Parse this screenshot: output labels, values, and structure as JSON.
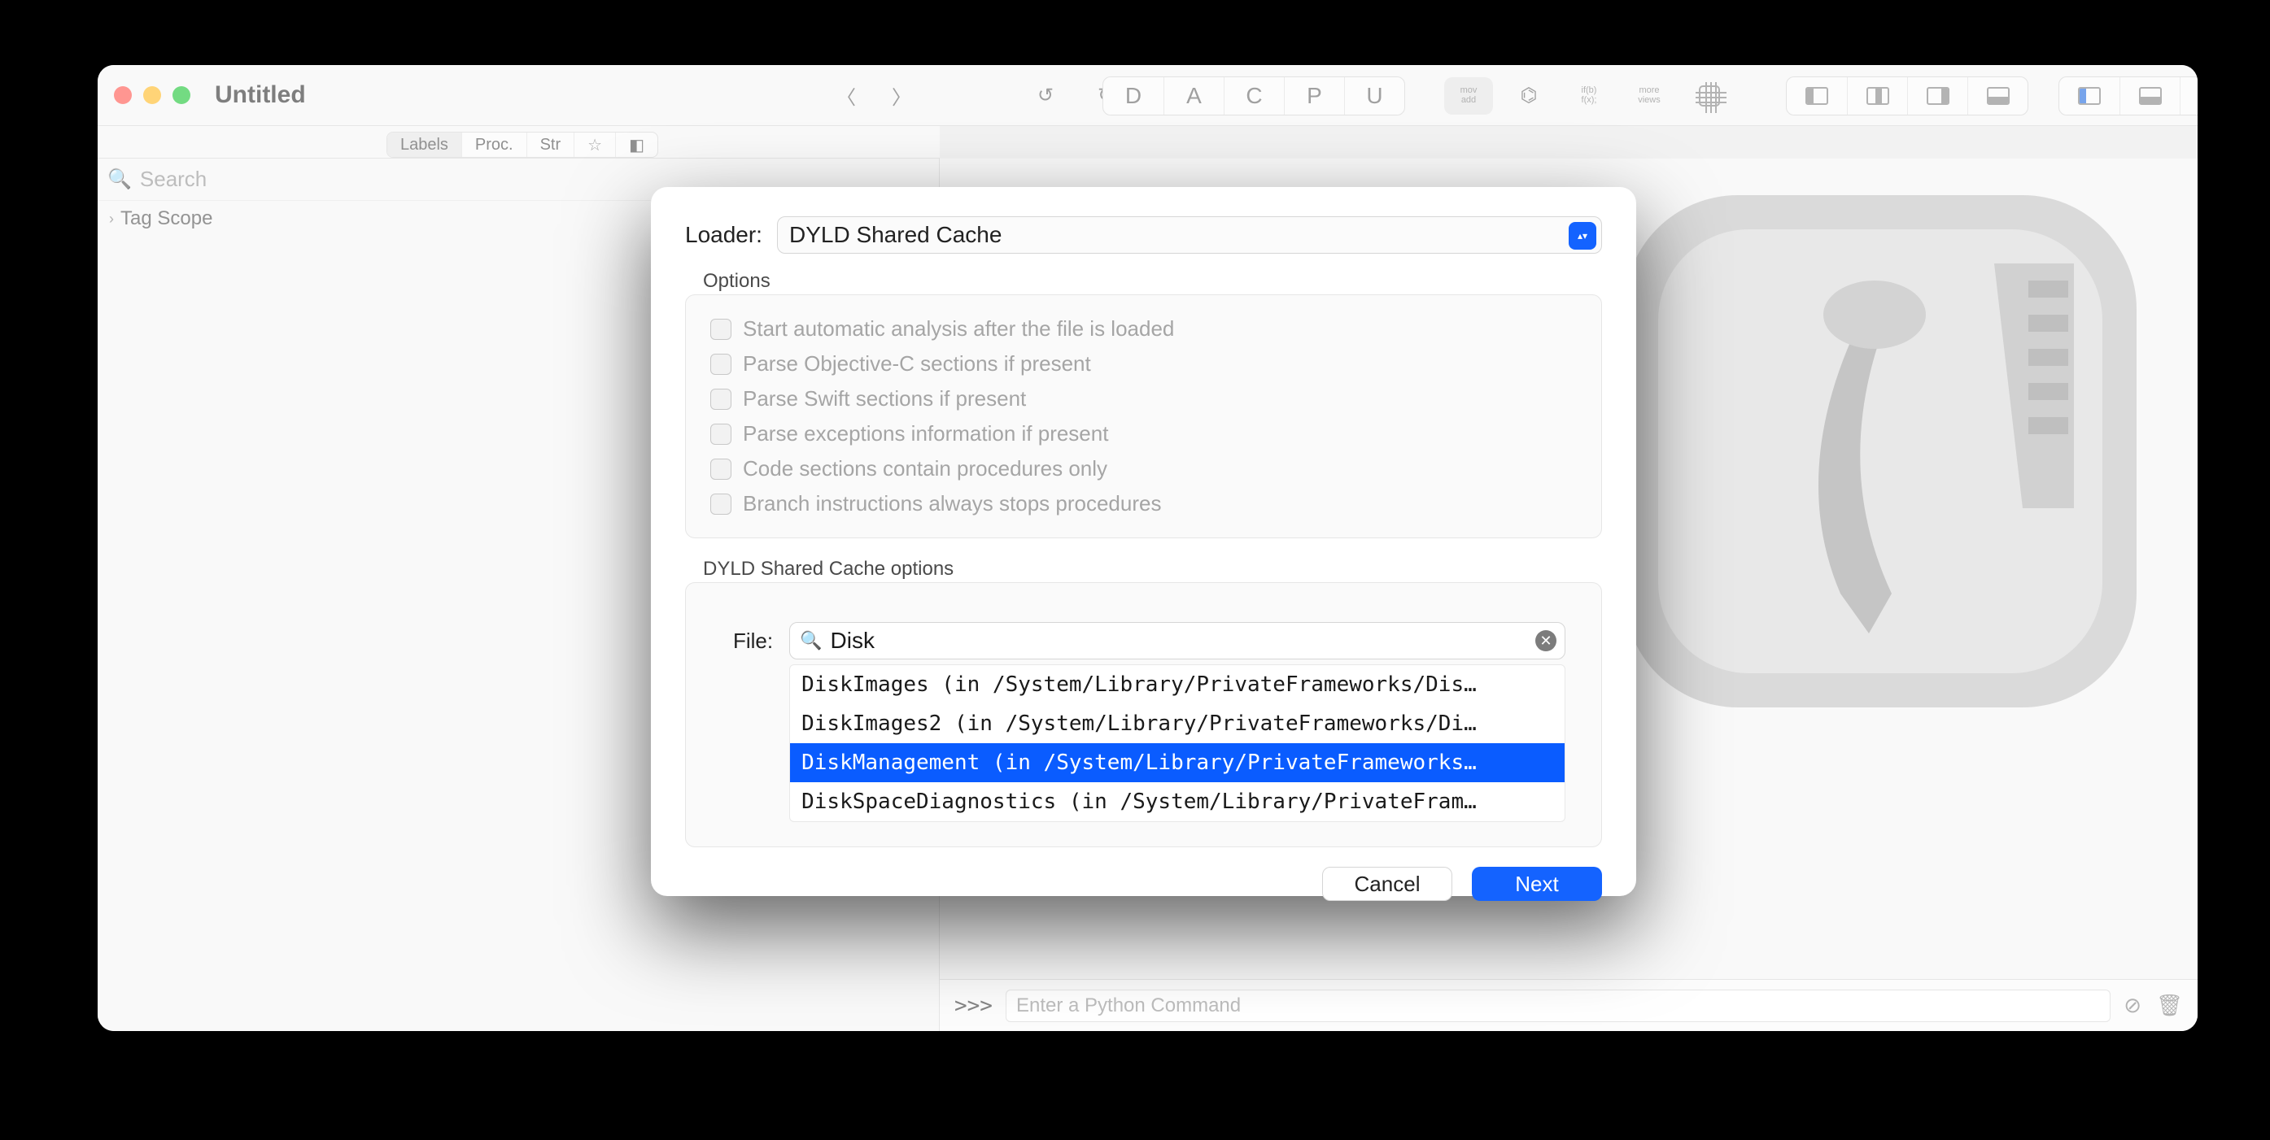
{
  "window": {
    "title": "Untitled"
  },
  "toolbar": {
    "letters": [
      "D",
      "A",
      "C",
      "P",
      "U"
    ]
  },
  "sidebar": {
    "tabs": [
      "Labels",
      "Proc.",
      "Str"
    ],
    "search_placeholder": "Search",
    "tree": [
      {
        "label": "Tag Scope"
      }
    ]
  },
  "console": {
    "prompt": ">>>",
    "placeholder": "Enter a Python Command"
  },
  "dialog": {
    "loader_label": "Loader:",
    "loader_value": "DYLD Shared Cache",
    "options_title": "Options",
    "options": [
      "Start automatic analysis after the file is loaded",
      "Parse Objective-C sections if present",
      "Parse Swift sections if present",
      "Parse exceptions information if present",
      "Code sections contain procedures only",
      "Branch instructions always stops procedures"
    ],
    "dyld_title": "DYLD Shared Cache options",
    "file_label": "File:",
    "file_search_value": "Disk",
    "file_items": [
      "DiskImages (in /System/Library/PrivateFrameworks/Dis…",
      "DiskImages2 (in /System/Library/PrivateFrameworks/Di…",
      "DiskManagement (in /System/Library/PrivateFrameworks…",
      "DiskSpaceDiagnostics (in /System/Library/PrivateFram…"
    ],
    "file_selected_index": 2,
    "cancel": "Cancel",
    "next": "Next"
  }
}
